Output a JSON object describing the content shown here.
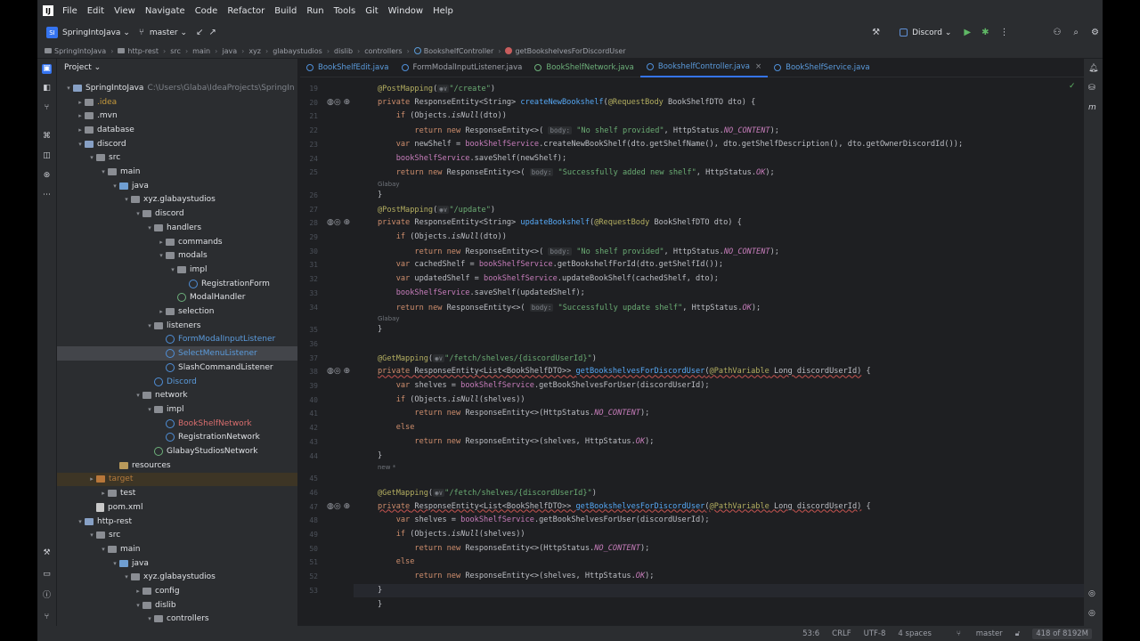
{
  "menu": [
    "File",
    "Edit",
    "View",
    "Navigate",
    "Code",
    "Refactor",
    "Build",
    "Run",
    "Tools",
    "Git",
    "Window",
    "Help"
  ],
  "toolbar": {
    "project_badge": "SI",
    "project_name": "SpringIntoJava",
    "branch": "master",
    "run_config": "Discord"
  },
  "breadcrumb": [
    "SpringIntoJava",
    "http-rest",
    "src",
    "main",
    "java",
    "xyz",
    "glabaystudios",
    "dislib",
    "controllers",
    "BookshelfController",
    "getBookshelvesForDiscordUser"
  ],
  "project_panel": {
    "title": "Project",
    "tree": [
      {
        "label": "SpringIntoJava",
        "extra": "C:\\Users\\Glaba\\IdeaProjects\\SpringIn",
        "indent": 0,
        "arrow": "▾",
        "icon": "mod"
      },
      {
        "label": ".idea",
        "indent": 1,
        "arrow": "▸",
        "icon": "folder",
        "color": "yel"
      },
      {
        "label": ".mvn",
        "indent": 1,
        "arrow": "▸",
        "icon": "folder"
      },
      {
        "label": "database",
        "indent": 1,
        "arrow": "▸",
        "icon": "folder"
      },
      {
        "label": "discord",
        "indent": 1,
        "arrow": "▾",
        "icon": "mod"
      },
      {
        "label": "src",
        "indent": 2,
        "arrow": "▾",
        "icon": "folder"
      },
      {
        "label": "main",
        "indent": 3,
        "arrow": "▾",
        "icon": "folder"
      },
      {
        "label": "java",
        "indent": 4,
        "arrow": "▾",
        "icon": "src"
      },
      {
        "label": "xyz.glabaystudios",
        "indent": 5,
        "arrow": "▾",
        "icon": "folder"
      },
      {
        "label": "discord",
        "indent": 6,
        "arrow": "▾",
        "icon": "folder"
      },
      {
        "label": "handlers",
        "indent": 7,
        "arrow": "▾",
        "icon": "folder"
      },
      {
        "label": "commands",
        "indent": 8,
        "arrow": "▸",
        "icon": "folder"
      },
      {
        "label": "modals",
        "indent": 8,
        "arrow": "▾",
        "icon": "folder"
      },
      {
        "label": "impl",
        "indent": 9,
        "arrow": "▾",
        "icon": "folder"
      },
      {
        "label": "RegistrationForm",
        "indent": 10,
        "arrow": "",
        "icon": "class"
      },
      {
        "label": "ModalHandler",
        "indent": 9,
        "arrow": "",
        "icon": "iface"
      },
      {
        "label": "selection",
        "indent": 8,
        "arrow": "▸",
        "icon": "folder"
      },
      {
        "label": "listeners",
        "indent": 7,
        "arrow": "▾",
        "icon": "folder"
      },
      {
        "label": "FormModalInputListener",
        "indent": 8,
        "arrow": "",
        "icon": "class",
        "color": "blue"
      },
      {
        "label": "SelectMenuListener",
        "indent": 8,
        "arrow": "",
        "icon": "class",
        "color": "blue",
        "selected": true
      },
      {
        "label": "SlashCommandListener",
        "indent": 8,
        "arrow": "",
        "icon": "class"
      },
      {
        "label": "Discord",
        "indent": 7,
        "arrow": "",
        "icon": "class",
        "color": "blue"
      },
      {
        "label": "network",
        "indent": 6,
        "arrow": "▾",
        "icon": "folder"
      },
      {
        "label": "impl",
        "indent": 7,
        "arrow": "▾",
        "icon": "folder"
      },
      {
        "label": "BookShelfNetwork",
        "indent": 8,
        "arrow": "",
        "icon": "class",
        "color": "red"
      },
      {
        "label": "RegistrationNetwork",
        "indent": 8,
        "arrow": "",
        "icon": "class"
      },
      {
        "label": "GlabayStudiosNetwork",
        "indent": 7,
        "arrow": "",
        "icon": "iface"
      },
      {
        "label": "resources",
        "indent": 4,
        "arrow": "",
        "icon": "res"
      },
      {
        "label": "target",
        "indent": 2,
        "arrow": "▸",
        "icon": "orange",
        "color": "org",
        "excluded": true
      },
      {
        "label": "test",
        "indent": 3,
        "arrow": "▸",
        "icon": "folder"
      },
      {
        "label": "pom.xml",
        "indent": 2,
        "arrow": "",
        "icon": "xml"
      },
      {
        "label": "http-rest",
        "indent": 1,
        "arrow": "▾",
        "icon": "mod"
      },
      {
        "label": "src",
        "indent": 2,
        "arrow": "▾",
        "icon": "folder"
      },
      {
        "label": "main",
        "indent": 3,
        "arrow": "▾",
        "icon": "folder"
      },
      {
        "label": "java",
        "indent": 4,
        "arrow": "▾",
        "icon": "src"
      },
      {
        "label": "xyz.glabaystudios",
        "indent": 5,
        "arrow": "▾",
        "icon": "folder"
      },
      {
        "label": "config",
        "indent": 6,
        "arrow": "▸",
        "icon": "folder"
      },
      {
        "label": "dislib",
        "indent": 6,
        "arrow": "▾",
        "icon": "folder"
      },
      {
        "label": "controllers",
        "indent": 7,
        "arrow": "▾",
        "icon": "folder"
      }
    ]
  },
  "tabs": [
    {
      "label": "BookShelfEdit.java",
      "style": "blue"
    },
    {
      "label": "FormModalInputListener.java",
      "style": "normal"
    },
    {
      "label": "BookShelfNetwork.java",
      "style": "green"
    },
    {
      "label": "BookshelfController.java",
      "style": "active"
    },
    {
      "label": "BookShelfService.java",
      "style": "blue"
    }
  ],
  "editor": {
    "hints": [
      {
        "after_line": 7,
        "text": "Glabay"
      },
      {
        "after_line": 16,
        "text": "Glabay"
      },
      {
        "after_line": 26,
        "text": "new *"
      }
    ],
    "lines": [
      {
        "n": "19",
        "html": "<span class='an'>@PostMapping</span>(<span class='ph-lbl'>◉∨</span><span class='str'>\"/create\"</span>)"
      },
      {
        "n": "20",
        "g": true,
        "html": "<span class='kw'>private</span> ResponseEntity&lt;String&gt; <span class='fn'>createNewBookshelf</span>(<span class='an'>@RequestBody</span> BookShelfDTO dto) {"
      },
      {
        "n": "21",
        "html": "    <span class='kw'>if</span> (Objects.<i>isNull</i>(dto))"
      },
      {
        "n": "22",
        "html": "        <span class='kw'>return new</span> ResponseEntity&lt;&gt;( <span class='ph-lbl'>body:</span> <span class='str'>\"No shelf provided\"</span>, HttpStatus.<span class='cn'>NO_CONTENT</span>);"
      },
      {
        "n": "23",
        "html": "    <span class='kw'>var</span> newShelf = <span class='fld'>bookShelfService</span>.createNewBookShelf(dto.getShelfName(), dto.getShelfDescription(), dto.getOwnerDiscordId());"
      },
      {
        "n": "24",
        "html": "    <span class='fld'>bookShelfService</span>.saveShelf(newShelf);"
      },
      {
        "n": "25",
        "html": "    <span class='kw'>return new</span> ResponseEntity&lt;&gt;( <span class='ph-lbl'>body:</span> <span class='str'>\"Successfully added new shelf\"</span>, HttpStatus.<span class='cn'>OK</span>);"
      },
      {
        "n": "26",
        "html": "}"
      },
      {
        "n": "27",
        "html": "<span class='an'>@PostMapping</span>(<span class='ph-lbl'>◉∨</span><span class='str'>\"/update\"</span>)"
      },
      {
        "n": "28",
        "g": true,
        "html": "<span class='kw'>private</span> ResponseEntity&lt;String&gt; <span class='fn'>updateBookshelf</span>(<span class='an'>@RequestBody</span> BookShelfDTO dto) {"
      },
      {
        "n": "29",
        "html": "    <span class='kw'>if</span> (Objects.<i>isNull</i>(dto))"
      },
      {
        "n": "30",
        "html": "        <span class='kw'>return new</span> ResponseEntity&lt;&gt;( <span class='ph-lbl'>body:</span> <span class='str'>\"No shelf provided\"</span>, HttpStatus.<span class='cn'>NO_CONTENT</span>);"
      },
      {
        "n": "31",
        "html": "    <span class='kw'>var</span> cachedShelf = <span class='fld'>bookShelfService</span>.getBookshelfForId(dto.getShelfId());"
      },
      {
        "n": "32",
        "html": "    <span class='kw'>var</span> updatedShelf = <span class='fld'>bookShelfService</span>.updateBookShelf(cachedShelf, dto);"
      },
      {
        "n": "33",
        "html": "    <span class='fld'>bookShelfService</span>.saveShelf(updatedShelf);"
      },
      {
        "n": "34",
        "html": "    <span class='kw'>return new</span> ResponseEntity&lt;&gt;( <span class='ph-lbl'>body:</span> <span class='str'>\"Successfully update shelf\"</span>, HttpStatus.<span class='cn'>OK</span>);"
      },
      {
        "n": "35",
        "html": "}"
      },
      {
        "n": "36",
        "html": ""
      },
      {
        "n": "37",
        "html": "<span class='an'>@GetMapping</span>(<span class='ph-lbl'>◉∨</span><span class='str'>\"/fetch/shelves/{discordUserId}\"</span>)"
      },
      {
        "n": "38",
        "g": true,
        "html": "<span class='kw red-ul'>private</span><span class='red-ul'> ResponseEntity&lt;List&lt;BookShelfDTO&gt;&gt; </span><span class='fn red-ul'>getBookshelvesForDiscordUser</span><span class='red-ul'>(</span><span class='an red-ul'>@PathVariable</span><span class='red-ul'> Long discordUserId)</span> {"
      },
      {
        "n": "39",
        "html": "    <span class='kw'>var</span> shelves = <span class='fld'>bookShelfService</span>.getBookShelvesForUser(discordUserId);"
      },
      {
        "n": "40",
        "html": "    <span class='kw'>if</span> (Objects.<i>isNull</i>(shelves))"
      },
      {
        "n": "41",
        "html": "        <span class='kw'>return new</span> ResponseEntity&lt;&gt;(HttpStatus.<span class='cn'>NO_CONTENT</span>);"
      },
      {
        "n": "42",
        "html": "    <span class='kw'>else</span>"
      },
      {
        "n": "43",
        "html": "        <span class='kw'>return new</span> ResponseEntity&lt;&gt;(shelves, HttpStatus.<span class='cn'>OK</span>);"
      },
      {
        "n": "44",
        "html": "}"
      },
      {
        "n": "45",
        "html": ""
      },
      {
        "n": "46",
        "html": "<span class='an'>@GetMapping</span>(<span class='ph-lbl'>◉∨</span><span class='str'>\"/fetch/shelves/{discordUserId}\"</span>)"
      },
      {
        "n": "47",
        "g": true,
        "html": "<span class='kw red-ul'>private</span><span class='red-ul'> ResponseEntity&lt;List&lt;BookShelfDTO&gt;&gt; </span><span class='fn red-ul'>getBookshelvesForDiscordUser</span><span class='red-ul'>(</span><span class='an red-ul'>@PathVariable</span><span class='red-ul'> Long discordUserId)</span> {"
      },
      {
        "n": "48",
        "html": "    <span class='kw'>var</span> shelves = <span class='fld'>bookShelfService</span>.getBookShelvesForUser(discordUserId);"
      },
      {
        "n": "49",
        "html": "    <span class='kw'>if</span> (Objects.<i>isNull</i>(shelves))"
      },
      {
        "n": "50",
        "html": "        <span class='kw'>return new</span> ResponseEntity&lt;&gt;(HttpStatus.<span class='cn'>NO_CONTENT</span>);"
      },
      {
        "n": "51",
        "html": "    <span class='kw'>else</span>"
      },
      {
        "n": "52",
        "html": "        <span class='kw'>return new</span> ResponseEntity&lt;&gt;(shelves, HttpStatus.<span class='cn'>OK</span>);"
      },
      {
        "n": "53",
        "cur": true,
        "html": "}"
      },
      {
        "n": "",
        "html": "}"
      }
    ]
  },
  "status": {
    "position": "53:6",
    "line_sep": "CRLF",
    "encoding": "UTF-8",
    "indent": "4 spaces",
    "branch": "master",
    "memory": "418 of 8192M"
  }
}
